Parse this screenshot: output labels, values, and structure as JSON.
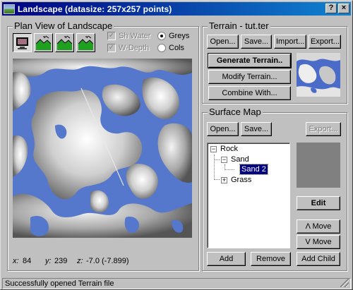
{
  "window": {
    "title": "Landscape (datasize: 257x257 points)",
    "icon": "landscape-app-icon",
    "help_glyph": "?",
    "close_glyph": "×"
  },
  "plan_view": {
    "title": "Plan View of Landscape",
    "mode_buttons": [
      {
        "name": "monitor-view-icon",
        "pressed": true
      },
      {
        "name": "terrain-view-1-icon",
        "pressed": false
      },
      {
        "name": "terrain-view-2-icon",
        "pressed": false
      },
      {
        "name": "terrain-view-3-icon",
        "pressed": false
      }
    ],
    "checkboxes": [
      {
        "label": "Sh Water",
        "checked": true,
        "enabled": false
      },
      {
        "label": "W-Depth",
        "checked": true,
        "enabled": false
      }
    ],
    "radios": [
      {
        "label": "Greys",
        "selected": true
      },
      {
        "label": "Cols",
        "selected": false
      }
    ],
    "coords": {
      "x_label": "x:",
      "x_value": "84",
      "y_label": "y:",
      "y_value": "239",
      "z_label": "z:",
      "z_value": "-7.0 (-7.899)"
    },
    "colors": {
      "water": "#5577cc",
      "land_light": "#ffffff",
      "land_dark": "#6e6e6e"
    }
  },
  "terrain": {
    "title": "Terrain - tut.ter",
    "buttons": {
      "open": "Open...",
      "save": "Save...",
      "import": "Import...",
      "export": "Export...",
      "generate": "Generate Terrain..",
      "modify": "Modify Terrain...",
      "combine": "Combine With..."
    }
  },
  "surface_map": {
    "title": "Surface Map",
    "buttons": {
      "open": "Open...",
      "save": "Save...",
      "export": "Export...",
      "edit": "Edit",
      "move_up": "Λ Move",
      "move_down": "V Move",
      "add": "Add",
      "remove": "Remove",
      "add_child": "Add Child"
    },
    "tree": [
      {
        "label": "Rock",
        "expanded": true,
        "level": 0
      },
      {
        "label": "Sand",
        "expanded": true,
        "level": 1
      },
      {
        "label": "Sand 2",
        "level": 2,
        "selected": true
      },
      {
        "label": "Grass",
        "expanded": false,
        "level": 1
      }
    ],
    "tree_glyphs": {
      "collapse": "−",
      "expand": "+"
    }
  },
  "status": {
    "text": "Successfully opened Terrain file"
  }
}
